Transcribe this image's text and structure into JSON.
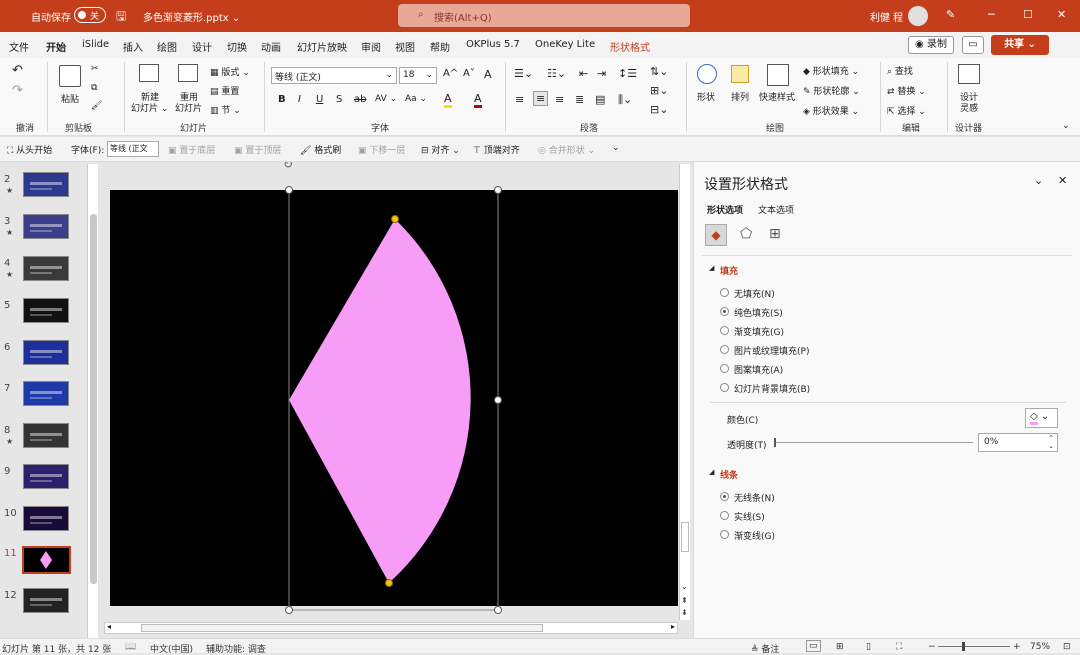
{
  "titlebar": {
    "autosave_label": "自动保存",
    "autosave_state": "关",
    "filename": "多色渐变菱形.pptx ⌄",
    "search_placeholder": "搜索(Alt+Q)",
    "user_name": "利健 程",
    "accent": "#c43e1c"
  },
  "menu": {
    "items": [
      "文件",
      "开始",
      "iSlide",
      "插入",
      "绘图",
      "设计",
      "切换",
      "动画",
      "幻灯片放映",
      "审阅",
      "视图",
      "帮助",
      "OKPlus 5.7",
      "OneKey Lite",
      "形状格式"
    ],
    "record_label": "◉ 录制",
    "share_label": "共享 ⌄"
  },
  "ribbon": {
    "undo_group": "撤消",
    "clipboard": {
      "paste": "粘贴",
      "group": "剪贴板"
    },
    "slides": {
      "new_slide": [
        "新建",
        "幻灯片 ⌄"
      ],
      "reuse_slide": [
        "重用",
        "幻灯片"
      ],
      "layout": "版式 ⌄",
      "reset": "重置",
      "section": "节 ⌄",
      "group": "幻灯片"
    },
    "font": {
      "name": "等线 (正文)",
      "size": "18",
      "bold": "B",
      "italic": "I",
      "underline": "U",
      "strike": "S",
      "strike2": "ab",
      "spacing": "AV ⌄",
      "case": "Aa ⌄",
      "grow": "A^",
      "shrink": "A˅",
      "clear": "A",
      "highlight": "A",
      "color": "A",
      "group": "字体"
    },
    "paragraph": {
      "group": "段落"
    },
    "drawing": {
      "shape": "形状",
      "arrange": "排列",
      "quick_styles": "快速样式",
      "fill": "形状填充 ⌄",
      "outline": "形状轮廓 ⌄",
      "effects": "形状效果 ⌄",
      "group": "绘图"
    },
    "editing": {
      "find": "查找",
      "replace": "替换 ⌄",
      "select": "选择 ⌄",
      "group": "编辑"
    },
    "designer": {
      "label": [
        "设计",
        "灵感"
      ],
      "group": "设计器"
    }
  },
  "quickbar": {
    "items": [
      {
        "label": "从头开始",
        "enabled": true
      },
      {
        "label": "字体(F):",
        "enabled": true
      },
      {
        "label": "置于底层",
        "enabled": false
      },
      {
        "label": "置于顶层",
        "enabled": false
      },
      {
        "label": "格式刷",
        "enabled": true
      },
      {
        "label": "下移一层",
        "enabled": false
      },
      {
        "label": "对齐 ⌄",
        "enabled": true
      },
      {
        "label": "顶端对齐",
        "enabled": true
      },
      {
        "label": "合并形状 ⌄",
        "enabled": false
      }
    ],
    "font_value": "等线 (正文"
  },
  "thumbnails": [
    {
      "num": "2",
      "star": true,
      "color": "#2b3a8f"
    },
    {
      "num": "3",
      "star": true,
      "color": "#3b3f8a"
    },
    {
      "num": "4",
      "star": true,
      "color": "#3a3a3a"
    },
    {
      "num": "5",
      "star": false,
      "color": "#111111"
    },
    {
      "num": "6",
      "star": false,
      "color": "#1f2f9a"
    },
    {
      "num": "7",
      "star": false,
      "color": "#1d3aa8"
    },
    {
      "num": "8",
      "star": true,
      "color": "#343434"
    },
    {
      "num": "9",
      "star": false,
      "color": "#2d1f6b"
    },
    {
      "num": "10",
      "star": false,
      "color": "#1a0a3a"
    },
    {
      "num": "11",
      "star": false,
      "color": "#000000",
      "selected": true
    },
    {
      "num": "12",
      "star": false,
      "color": "#222222"
    }
  ],
  "slide": {
    "shape_fill": "#f79cf7",
    "background": "#000000"
  },
  "pane": {
    "title": "设置形状格式",
    "tabs": [
      "形状选项",
      "文本选项"
    ],
    "fill_section": "填充",
    "fill_options": [
      {
        "label": "无填充(N)",
        "checked": false
      },
      {
        "label": "纯色填充(S)",
        "checked": true
      },
      {
        "label": "渐变填充(G)",
        "checked": false
      },
      {
        "label": "图片或纹理填充(P)",
        "checked": false
      },
      {
        "label": "图案填充(A)",
        "checked": false
      },
      {
        "label": "幻灯片背景填充(B)",
        "checked": false
      }
    ],
    "color_label": "颜色(C)",
    "transparency_label": "透明度(T)",
    "transparency_value": "0%",
    "line_section": "线条",
    "line_options": [
      {
        "label": "无线条(N)",
        "checked": true
      },
      {
        "label": "实线(S)",
        "checked": false
      },
      {
        "label": "渐变线(G)",
        "checked": false
      }
    ]
  },
  "status": {
    "slide_info": "幻灯片 第 11 张，共 12 张",
    "language": "中文(中国)",
    "accessibility": "辅助功能: 调查",
    "notes": "≜ 备注",
    "zoom": "75%"
  }
}
